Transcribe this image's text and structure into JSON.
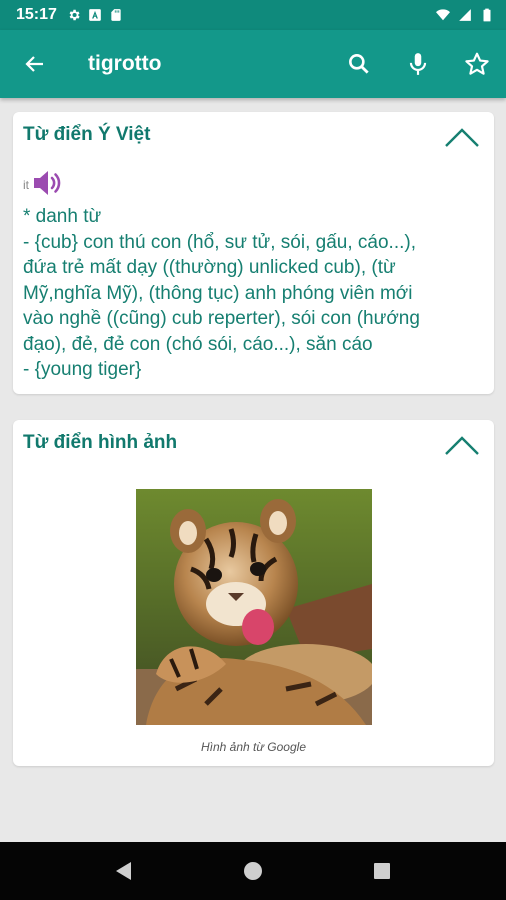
{
  "status_bar": {
    "time": "15:17",
    "left_icons": [
      "gear-icon",
      "a-box-icon",
      "sd-card-icon"
    ],
    "right_icons": [
      "wifi-icon",
      "signal-icon",
      "battery-icon"
    ]
  },
  "app_bar": {
    "back_icon": "arrow-left-icon",
    "title": "tigrotto",
    "actions": [
      "search-icon",
      "microphone-icon",
      "star-outline-icon"
    ],
    "color": "#13988a"
  },
  "dictionary_card": {
    "title": "Từ điển Ý Việt",
    "lang_code": "it",
    "lines": [
      "* danh từ",
      "- {cub} con thú con (hổ, sư tử, sói, gấu, cáo...),",
      "đứa trẻ mất dạy ((thường) unlicked cub), (từ",
      "Mỹ,nghĩa Mỹ),  (thông tục) anh phóng viên mới",
      "vào nghề ((cũng) cub reperter), sói con (hướng",
      "đạo), đẻ, đẻ con (chó sói, cáo...), săn cáo",
      "- {young tiger}"
    ],
    "accent_color": "#11796d",
    "speaker_color": "#9b4bb0"
  },
  "image_card": {
    "title": "Từ điển hình ảnh",
    "caption": "Hình ảnh từ Google"
  },
  "nav_bar": {
    "buttons": [
      "back-triangle-icon",
      "home-circle-icon",
      "recents-square-icon"
    ]
  }
}
